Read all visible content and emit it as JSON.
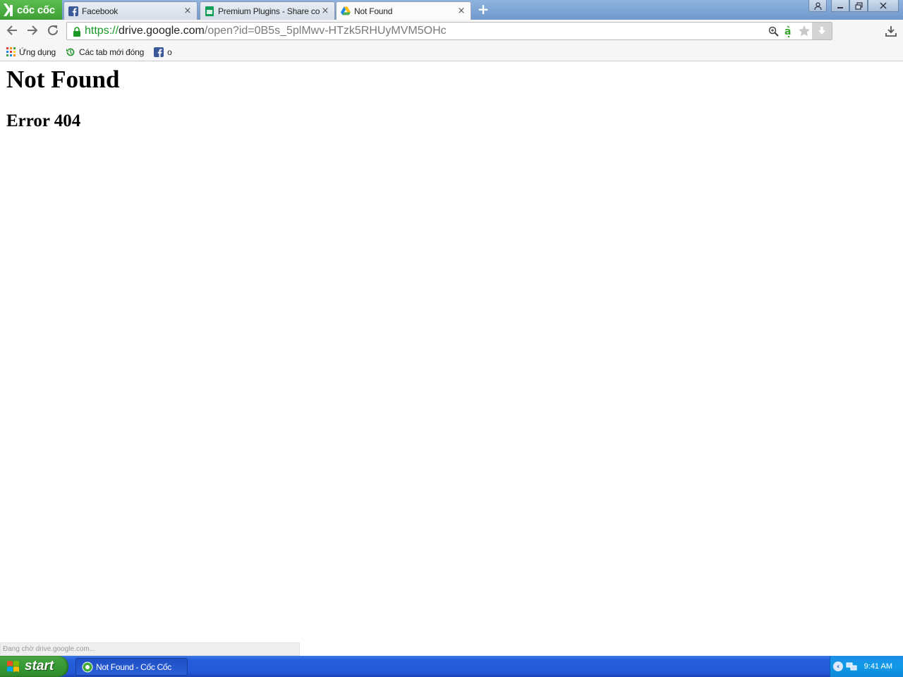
{
  "browser": {
    "brand": "cốc cốc",
    "tabs": [
      {
        "title": "Facebook",
        "icon": "facebook-icon",
        "active": false
      },
      {
        "title": "Premium Plugins - Share config",
        "icon": "sheets-icon",
        "active": false
      },
      {
        "title": "Not Found",
        "icon": "google-drive-icon",
        "active": true
      }
    ],
    "close_glyph": "×",
    "new_tab_glyph": "+",
    "window_buttons": {
      "user": "user-icon",
      "minimize": "minimize-icon",
      "restore": "restore-icon",
      "close": "close-icon"
    }
  },
  "address": {
    "scheme": "https://",
    "host": "drive.google.com",
    "path": "/open?id=0B5s_5plMwv-HTzk5RHUyMVM5OHc",
    "secure": true
  },
  "bookmarks": [
    {
      "label": "Ứng dụng",
      "icon": "apps-grid-icon"
    },
    {
      "label": "Các tab mới đóng",
      "icon": "recent-tabs-icon"
    },
    {
      "label": "o",
      "icon": "facebook-icon"
    }
  ],
  "page": {
    "heading": "Not Found",
    "subheading": "Error 404"
  },
  "status_bar": "Đang chờ drive.google.com...",
  "taskbar": {
    "start_label": "start",
    "task_label": "Not Found - Cốc Cốc",
    "clock": "9:41 AM"
  },
  "colors": {
    "brand_green": "#3f9f36",
    "url_scheme_green": "#1a9a25",
    "taskbar_blue": "#245edb",
    "start_green": "#379a34"
  }
}
